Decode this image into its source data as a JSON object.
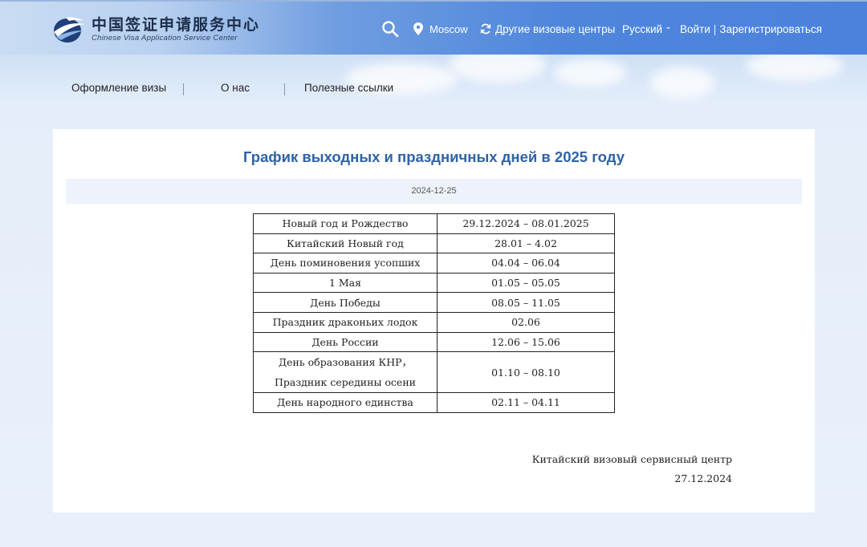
{
  "header": {
    "logo_cn": "中国签证申请服务中心",
    "logo_en": "Chinese Visa Application Service Center",
    "location": "Moscow",
    "other_centers": "Другие визовые центры",
    "language": "Русский",
    "login": "Войти",
    "separator": "|",
    "register": "Зарегистрироваться"
  },
  "nav": {
    "items": [
      "Оформление визы",
      "О нас",
      "Полезные ссылки"
    ],
    "separator": "|"
  },
  "article": {
    "title": "График выходных и праздничных дней в 2025 году",
    "date": "2024-12-25",
    "rows": [
      {
        "holiday": "Новый год и Рождество",
        "period": "29.12.2024 – 08.01.2025"
      },
      {
        "holiday": "Китайский Новый год",
        "period": "28.01 – 4.02"
      },
      {
        "holiday": "День поминовения усопших",
        "period": "04.04 – 06.04"
      },
      {
        "holiday": "1 Мая",
        "period": "01.05 – 05.05"
      },
      {
        "holiday": "День Победы",
        "period": "08.05 – 11.05"
      },
      {
        "holiday": "Праздник драконьих лодок",
        "period": "02.06"
      },
      {
        "holiday": "День России",
        "period": "12.06 – 15.06"
      },
      {
        "holiday": "День образования КНР，",
        "holiday_line2": "Праздник середины осени",
        "period": "01.10 – 08.10"
      },
      {
        "holiday": "День народного единства",
        "period": "02.11 – 04.11"
      }
    ],
    "signature": "Китайский визовый сервисный центр",
    "signature_date": "27.12.2024"
  },
  "colors": {
    "title": "#2f63a7",
    "header_blue": "#4a82dc"
  },
  "icons": [
    "globe-logo-icon",
    "search-icon",
    "location-pin-icon",
    "refresh-icon",
    "chevron-down-icon"
  ]
}
